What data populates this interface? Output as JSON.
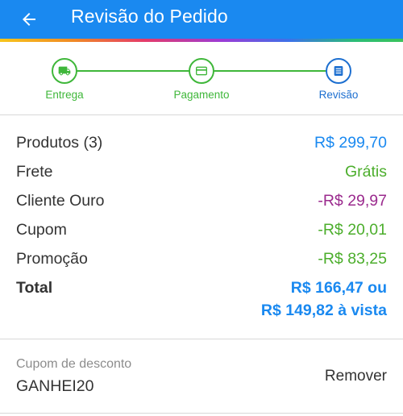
{
  "header": {
    "title": "Revisão do Pedido",
    "back_icon": "arrow-left-icon",
    "background": "#1a89f0"
  },
  "stepper": {
    "steps": [
      {
        "label": "Entrega",
        "icon": "truck-icon",
        "state": "done"
      },
      {
        "label": "Pagamento",
        "icon": "credit-card-icon",
        "state": "done"
      },
      {
        "label": "Revisão",
        "icon": "list-icon",
        "state": "active"
      }
    ],
    "done_color": "#3fb73a",
    "active_color": "#1d6fd0"
  },
  "summary": {
    "rows": [
      {
        "label": "Produtos (3)",
        "value": "R$ 299,70",
        "color": "#1a89f0"
      },
      {
        "label": "Frete",
        "value": "Grátis",
        "color": "#4cae2c"
      },
      {
        "label": "Cliente Ouro",
        "value": "-R$ 29,97",
        "color": "#9b2b8e"
      },
      {
        "label": "Cupom",
        "value": "-R$ 20,01",
        "color": "#4cae2c"
      },
      {
        "label": "Promoção",
        "value": "-R$ 83,25",
        "color": "#4cae2c"
      }
    ],
    "total": {
      "label": "Total",
      "value_line1": "R$ 166,47 ou",
      "value_line2": "R$ 149,82 à vista"
    }
  },
  "coupon": {
    "label": "Cupom de desconto",
    "code": "GANHEI20",
    "remove_label": "Remover"
  }
}
